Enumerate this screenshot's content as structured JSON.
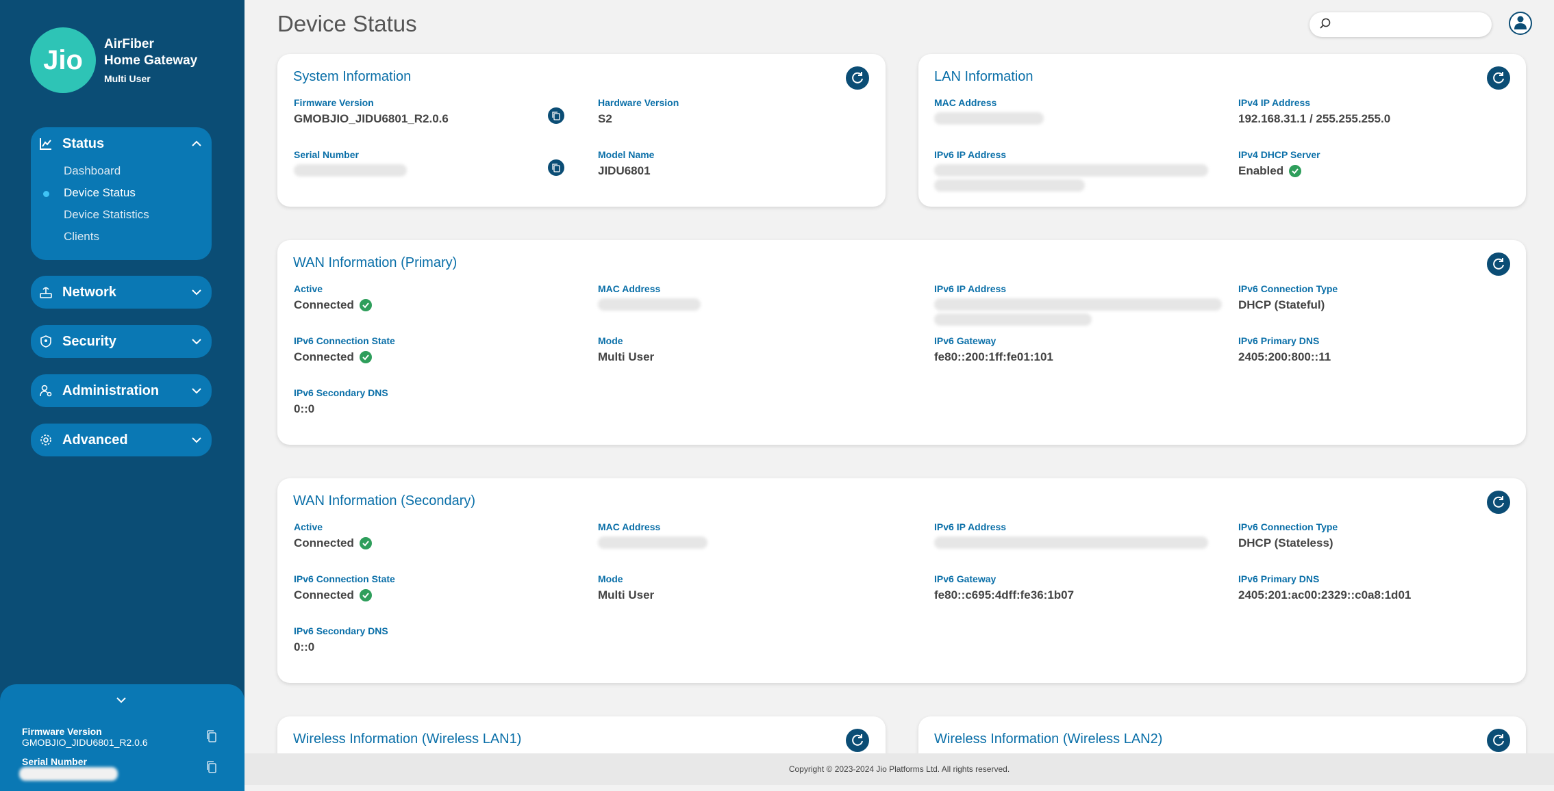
{
  "brand": {
    "logo": "Jio",
    "title_line1": "AirFiber",
    "title_line2": "Home Gateway",
    "subtitle": "Multi User"
  },
  "sidebar": {
    "status": {
      "label": "Status",
      "icon": "chart-icon",
      "items": [
        {
          "label": "Dashboard",
          "active": false
        },
        {
          "label": "Device Status",
          "active": true
        },
        {
          "label": "Device Statistics",
          "active": false
        },
        {
          "label": "Clients",
          "active": false
        }
      ]
    },
    "network": {
      "label": "Network",
      "icon": "router-icon"
    },
    "security": {
      "label": "Security",
      "icon": "shield-icon"
    },
    "administration": {
      "label": "Administration",
      "icon": "admin-icon"
    },
    "advanced": {
      "label": "Advanced",
      "icon": "gear-icon"
    },
    "footer": {
      "firmware_label": "Firmware Version",
      "firmware_value": "GMOBJIO_JIDU6801_R2.0.6",
      "serial_label": "Serial Number"
    }
  },
  "page": {
    "title": "Device Status"
  },
  "search": {
    "placeholder": ""
  },
  "system_info": {
    "title": "System Information",
    "firmware_label": "Firmware Version",
    "firmware_value": "GMOBJIO_JIDU6801_R2.0.6",
    "hardware_label": "Hardware Version",
    "hardware_value": "S2",
    "serial_label": "Serial Number",
    "model_label": "Model Name",
    "model_value": "JIDU6801"
  },
  "lan_info": {
    "title": "LAN Information",
    "mac_label": "MAC Address",
    "ipv4_label": "IPv4 IP Address",
    "ipv4_value": "192.168.31.1 / 255.255.255.0",
    "ipv6_label": "IPv6 IP Address",
    "dhcp_label": "IPv4 DHCP Server",
    "dhcp_value": "Enabled"
  },
  "wan_primary": {
    "title": "WAN Information (Primary)",
    "active_label": "Active",
    "active_value": "Connected",
    "mac_label": "MAC Address",
    "ipv6_label": "IPv6 IP Address",
    "conn_type_label": "IPv6 Connection Type",
    "conn_type_value": "DHCP (Stateful)",
    "conn_state_label": "IPv6 Connection State",
    "conn_state_value": "Connected",
    "mode_label": "Mode",
    "mode_value": "Multi User",
    "gateway_label": "IPv6 Gateway",
    "gateway_value": "fe80::200:1ff:fe01:101",
    "primary_dns_label": "IPv6 Primary DNS",
    "primary_dns_value": "2405:200:800::11",
    "secondary_dns_label": "IPv6 Secondary DNS",
    "secondary_dns_value": "0::0"
  },
  "wan_secondary": {
    "title": "WAN Information (Secondary)",
    "active_label": "Active",
    "active_value": "Connected",
    "mac_label": "MAC Address",
    "ipv6_label": "IPv6 IP Address",
    "conn_type_label": "IPv6 Connection Type",
    "conn_type_value": "DHCP (Stateless)",
    "conn_state_label": "IPv6 Connection State",
    "conn_state_value": "Connected",
    "mode_label": "Mode",
    "mode_value": "Multi User",
    "gateway_label": "IPv6 Gateway",
    "gateway_value": "fe80::c695:4dff:fe36:1b07",
    "primary_dns_label": "IPv6 Primary DNS",
    "primary_dns_value": "2405:201:ac00:2329::c0a8:1d01",
    "secondary_dns_label": "IPv6 Secondary DNS",
    "secondary_dns_value": "0::0"
  },
  "wireless1": {
    "title": "Wireless Information (Wireless LAN1)"
  },
  "wireless2": {
    "title": "Wireless Information (Wireless LAN2)"
  },
  "footer": {
    "copyright": "Copyright © 2023-2024 Jio Platforms Ltd. All rights reserved."
  },
  "colors": {
    "sidebar": "#0b4d75",
    "nav_group": "#0a78b4",
    "accent": "#0a6fa8",
    "logo": "#2ec4b6",
    "success": "#2e9e5b"
  }
}
